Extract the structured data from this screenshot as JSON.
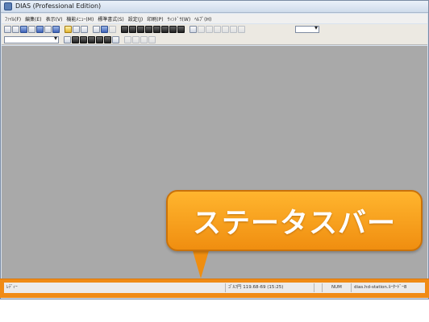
{
  "window": {
    "title": "DIAS (Professional Edition)"
  },
  "menubar": {
    "items": [
      "ﾌｧｲﾙ(F)",
      "編集(E)",
      "表示(V)",
      "機能ﾒﾆｭｰ(M)",
      "標準書式(S)",
      "設定(J)",
      "印刷(P)",
      "ｳｨﾝﾄﾞｳ(W)",
      "ﾍﾙﾌﾟ(H)"
    ]
  },
  "statusbar": {
    "ready_text": "ﾚﾃﾞｨｰ",
    "coordinate_text": "ｺﾞﾙﾌ円 119.68-69 (15:25)",
    "num_text": "NUM",
    "host_text": "dias.hd-station.ﾙｰﾀｰﾄﾞｰ8"
  },
  "callout": {
    "text": "ステータスバー"
  },
  "colors": {
    "workspace": "#a9a9a9",
    "highlight": "#f08b16",
    "callout_fill": "#f39a17",
    "callout_text": "#ffffff"
  },
  "icons": {
    "toolbar1": [
      "new-icon",
      "open-icon",
      "save-icon",
      "grid-icon",
      "table-icon",
      "text-icon",
      "image-icon",
      "color-icon",
      "pen-icon",
      "map-icon",
      "print-icon",
      "fill-icon",
      "blue-square-icon",
      "home-icon",
      "house-icon",
      "drawer-icon",
      "tool-icon",
      "copy-icon",
      "paste-icon",
      "layer-icon",
      "pointer-icon",
      "cursor-icon",
      "line-icon",
      "curve-icon",
      "shape-icon",
      "circle-icon",
      "arc-icon",
      "wave-icon"
    ],
    "toolbar2": [
      "tool-a-icon",
      "tool-b-icon",
      "tool-c-icon",
      "tool-d-icon",
      "tool-e-icon",
      "tool-f-icon",
      "tool-g-icon",
      "nav-left-icon",
      "nav-right-icon",
      "nav-up-icon",
      "nav-lock-icon"
    ]
  }
}
